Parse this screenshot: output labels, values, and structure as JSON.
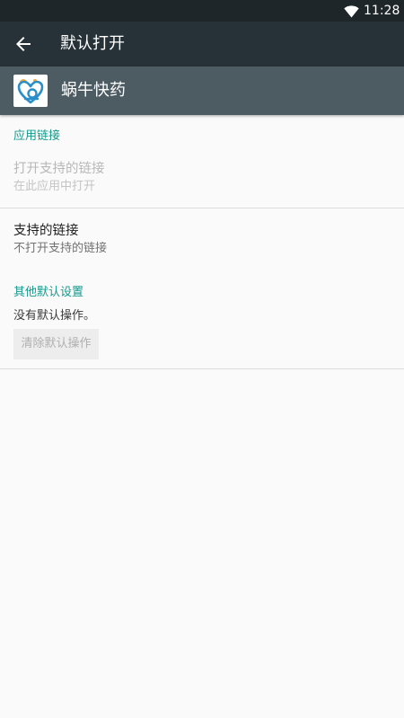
{
  "status_bar": {
    "time": "11:28",
    "wifi_icon": "wifi-icon"
  },
  "toolbar": {
    "back_icon": "arrow-back-icon",
    "title": "默认打开"
  },
  "app": {
    "icon": "app-logo-icon",
    "name": "蜗牛快药"
  },
  "app_links_section": {
    "title": "应用链接",
    "open_supported_links": {
      "title": "打开支持的链接",
      "subtitle": "在此应用中打开"
    }
  },
  "supported_links": {
    "title": "支持的链接",
    "subtitle": "不打开支持的链接"
  },
  "other_defaults_section": {
    "title": "其他默认设置",
    "message": "没有默认操作。",
    "clear_button": "清除默认操作"
  },
  "colors": {
    "status_bar": "#1f262a",
    "toolbar": "#263238",
    "app_header": "#4d5b63",
    "accent": "#159a8c",
    "background": "#fafafa"
  }
}
